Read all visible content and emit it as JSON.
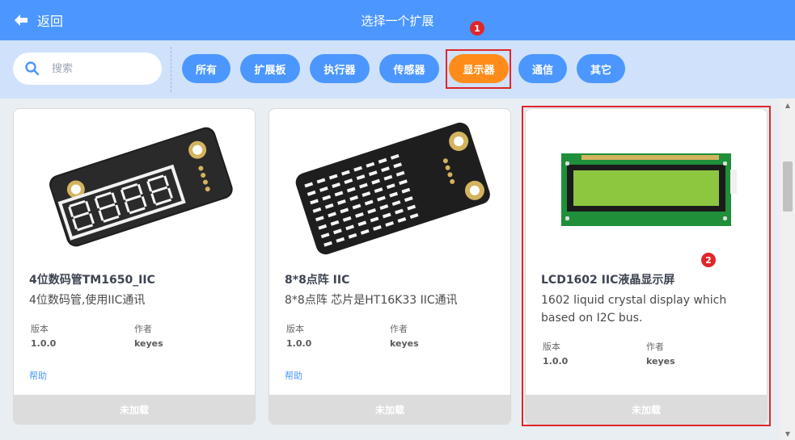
{
  "header": {
    "back_label": "返回",
    "title": "选择一个扩展"
  },
  "search": {
    "placeholder": "搜索"
  },
  "filters": [
    {
      "label": "所有",
      "active": false
    },
    {
      "label": "扩展板",
      "active": false
    },
    {
      "label": "执行器",
      "active": false
    },
    {
      "label": "传感器",
      "active": false
    },
    {
      "label": "显示器",
      "active": true
    },
    {
      "label": "通信",
      "active": false
    },
    {
      "label": "其它",
      "active": false
    }
  ],
  "annotations": {
    "badge1": "1",
    "badge2": "2"
  },
  "cards": [
    {
      "name": "4位数码管TM1650_IIC",
      "desc": "4位数码管,使用IIC通讯",
      "version_label": "版本",
      "version": "1.0.0",
      "author_label": "作者",
      "author": "keyes",
      "help": "帮助",
      "status": "未加载",
      "image": {
        "module_text": "CLK DIO V G"
      }
    },
    {
      "name": "8*8点阵 IIC",
      "desc": "8*8点阵 芯片是HT16K33 IIC通讯",
      "version_label": "版本",
      "version": "1.0.0",
      "author_label": "作者",
      "author": "keyes",
      "help": "帮助",
      "status": "未加载",
      "image": {
        "module_text": "SCL SDA V G"
      }
    },
    {
      "name": "LCD1602 IIC液晶显示屏",
      "desc": "1602 liquid crystal display which based on I2C bus.",
      "version_label": "版本",
      "version": "1.0.0",
      "author_label": "作者",
      "author": "keyes",
      "status": "未加载",
      "image": {
        "module_text": "1602A"
      }
    }
  ],
  "colors": {
    "primary": "#4c97ff",
    "active": "#ff8c1a",
    "highlight": "#e0262b"
  }
}
